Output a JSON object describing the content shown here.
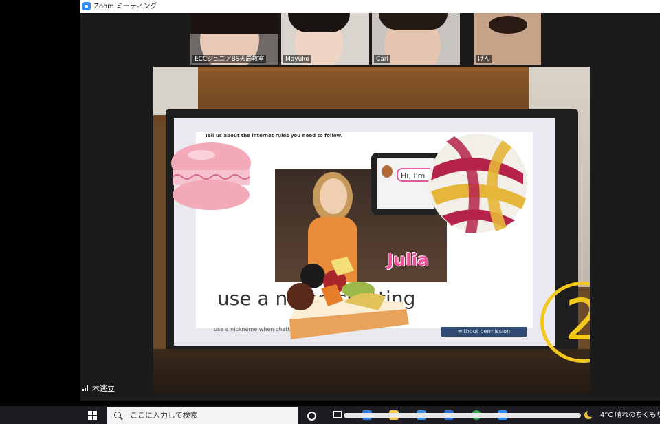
{
  "window": {
    "title": "Zoom ミーティング",
    "icon": "zoom-app-icon"
  },
  "participants": [
    {
      "name": "ECCジュニアBS天辰教室"
    },
    {
      "name": "Mayuko"
    },
    {
      "name": "Carl"
    },
    {
      "name": "げん"
    }
  ],
  "shared_video": {
    "slide_instruction": "Tell us about the internet rules you need to follow.",
    "bubble_text": "Hi, I'm",
    "caption": "use a n        hen chatting",
    "name_tag": "Julia",
    "subcaption_left": "use a nickname when chatting",
    "subcaption_right": "without permission",
    "overlay_number": "2",
    "stickers": [
      "macaron-sticker",
      "candy-ball-sticker",
      "fruit-tart-sticker"
    ]
  },
  "active_speaker": {
    "label": "木逃立"
  },
  "taskbar": {
    "search_placeholder": "ここに入力して検索",
    "temperature": "4°C",
    "weather": "晴れのちくもり"
  },
  "colors": {
    "zoom_blue": "#2d8cff",
    "overlay_gold": "#f2c81c",
    "julia_pink": "#f04f9c"
  }
}
